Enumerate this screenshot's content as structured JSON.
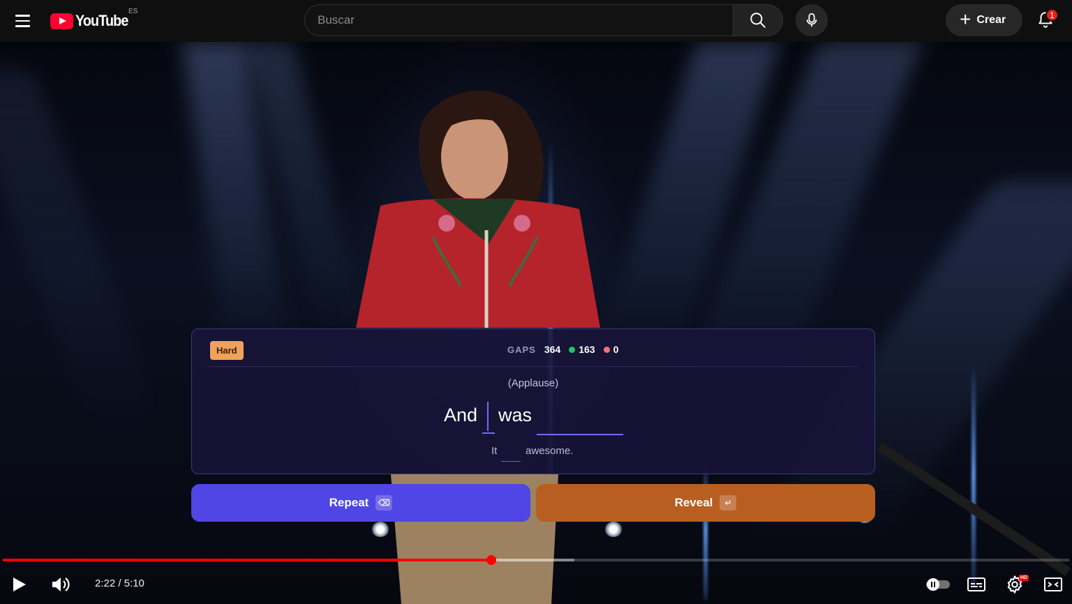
{
  "header": {
    "logo_text": "YouTube",
    "region": "ES",
    "search_placeholder": "Buscar",
    "create_label": "Crear",
    "notification_count": "1"
  },
  "card": {
    "difficulty": "Hard",
    "stats_label": "GAPS",
    "total_gaps": "364",
    "correct": "163",
    "wrong": "0",
    "context_line": "(Applause)",
    "words": [
      "And",
      "was"
    ],
    "hint_words": [
      "It",
      "awesome."
    ]
  },
  "actions": {
    "repeat_label": "Repeat",
    "repeat_key": "⌫",
    "reveal_label": "Reveal",
    "reveal_key": "↵"
  },
  "player": {
    "current_time": "2:22",
    "duration": "5:10",
    "time_display": "2:22 / 5:10",
    "played_fraction": 0.458,
    "buffered_fraction": 0.536
  },
  "colors": {
    "accent_progress": "#ff0000",
    "repeat_button": "#4f46e5",
    "reveal_button": "#b85e20",
    "hard_badge": "#f0a15c",
    "correct_dot": "#22c55e",
    "wrong_dot": "#f87171"
  },
  "icons": [
    "menu-icon",
    "youtube-logo-icon",
    "search-icon",
    "microphone-icon",
    "plus-icon",
    "bell-icon",
    "play-icon",
    "volume-icon",
    "autoplay-toggle-icon",
    "subtitles-icon",
    "settings-icon",
    "hd-icon",
    "theater-mode-icon"
  ]
}
